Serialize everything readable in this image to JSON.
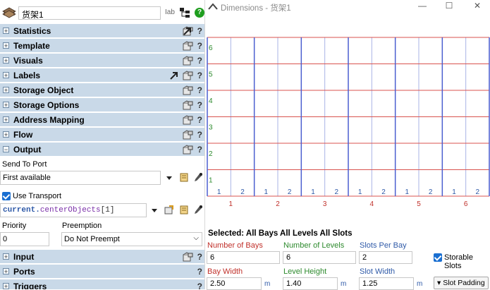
{
  "properties": {
    "object_name": "货架1",
    "tab_icon_text": "Iab",
    "sections": [
      {
        "label": "Statistics",
        "expanded": false
      },
      {
        "label": "Template",
        "expanded": false
      },
      {
        "label": "Visuals",
        "expanded": false
      },
      {
        "label": "Labels",
        "expanded": false
      },
      {
        "label": "Storage Object",
        "expanded": false
      },
      {
        "label": "Storage Options",
        "expanded": false
      },
      {
        "label": "Address Mapping",
        "expanded": false
      },
      {
        "label": "Flow",
        "expanded": false
      },
      {
        "label": "Output",
        "expanded": true
      },
      {
        "label": "Input",
        "expanded": false
      },
      {
        "label": "Ports",
        "expanded": false
      },
      {
        "label": "Triggers",
        "expanded": false
      }
    ],
    "output": {
      "send_to_port_label": "Send To Port",
      "send_to_port_value": "First available",
      "use_transport_label": "Use Transport",
      "use_transport_checked": true,
      "transport_code_prefix": "current.",
      "transport_code_method": "centerObjects",
      "transport_code_index": "[1]",
      "priority_label": "Priority",
      "priority_value": "0",
      "preemption_label": "Preemption",
      "preemption_value": "Do Not Preempt"
    },
    "help_symbol": "?"
  },
  "dimensions_window": {
    "title": "Dimensions - 货架1",
    "controls": {
      "minimize": "—",
      "maximize": "☐",
      "close": "✕"
    },
    "selection_title": "Selected: All Bays All Levels All Slots",
    "number_of_bays_label": "Number of Bays",
    "number_of_bays_value": "6",
    "number_of_levels_label": "Number of Levels",
    "number_of_levels_value": "6",
    "slots_per_bay_label": "Slots Per Bay",
    "slots_per_bay_value": "2",
    "storable_slots_label": "Storable Slots",
    "storable_slots_checked": true,
    "bay_width_label": "Bay Width",
    "bay_width_value": "2.50",
    "level_height_label": "Level Height",
    "level_height_value": "1.40",
    "slot_width_label": "Slot Width",
    "slot_width_value": "1.25",
    "unit": "m",
    "slot_padding_label": "▾ Slot Padding"
  },
  "rack_grid": {
    "bays": [
      "1",
      "2",
      "3",
      "4",
      "5",
      "6"
    ],
    "levels": [
      "1",
      "2",
      "3",
      "4",
      "5",
      "6"
    ],
    "slots": [
      "1",
      "2"
    ],
    "colors": {
      "bay_line": "#4b5fd0",
      "slot_line": "#a9b3e6",
      "level_line": "#d9534f",
      "level_text": "#2d8a2d",
      "bay_text": "#c0302a",
      "slot_text": "#2f5aa8"
    }
  },
  "colors": {
    "section_header_bg": "#c9d9e8",
    "accent_blue": "#1a6fd1"
  }
}
